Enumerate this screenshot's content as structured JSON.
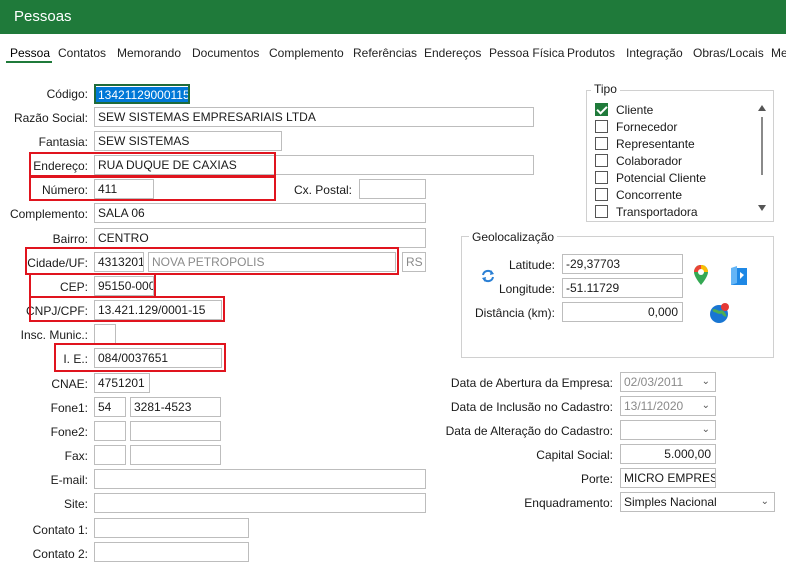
{
  "window": {
    "title": "Pessoas"
  },
  "tabs": [
    "Pessoa",
    "Contatos",
    "Memorando",
    "Documentos",
    "Complemento",
    "Referências",
    "Endereços",
    "Pessoa Física",
    "Produtos",
    "Integração",
    "Obras/Locais",
    "Me"
  ],
  "form": {
    "codigo": {
      "label": "Código:",
      "value": "13421129000115"
    },
    "razao_social": {
      "label": "Razão Social:",
      "value": "SEW SISTEMAS EMPRESARIAIS LTDA"
    },
    "fantasia": {
      "label": "Fantasia:",
      "value": "SEW SISTEMAS"
    },
    "endereco": {
      "label": "Endereço:",
      "value": "RUA DUQUE DE CAXIAS"
    },
    "numero": {
      "label": "Número:",
      "value": "411"
    },
    "cx_postal": {
      "label": "Cx. Postal:",
      "value": ""
    },
    "complemento": {
      "label": "Complemento:",
      "value": "SALA 06"
    },
    "bairro": {
      "label": "Bairro:",
      "value": "CENTRO"
    },
    "cidade_uf": {
      "label": "Cidade/UF:",
      "codigo": "4313201",
      "cidade": "NOVA PETROPOLIS",
      "uf": "RS"
    },
    "cep": {
      "label": "CEP:",
      "value": "95150-000"
    },
    "cnpj_cpf": {
      "label": "CNPJ/CPF:",
      "value": "13.421.129/0001-15"
    },
    "insc_munic": {
      "label": "Insc. Munic.:",
      "value": ""
    },
    "ie": {
      "label": "I. E.:",
      "value": "084/0037651"
    },
    "cnae": {
      "label": "CNAE:",
      "value": "4751201"
    },
    "fone1": {
      "label": "Fone1:",
      "ddd": "54",
      "numero": "3281-4523"
    },
    "fone2": {
      "label": "Fone2:",
      "ddd": "",
      "numero": ""
    },
    "fax": {
      "label": "Fax:",
      "ddd": "",
      "numero": ""
    },
    "email": {
      "label": "E-mail:",
      "value": ""
    },
    "site": {
      "label": "Site:",
      "value": ""
    },
    "contato1": {
      "label": "Contato 1:",
      "value": ""
    },
    "contato2": {
      "label": "Contato 2:",
      "value": ""
    }
  },
  "tipo": {
    "label": "Tipo",
    "items": [
      {
        "label": "Cliente",
        "checked": true
      },
      {
        "label": "Fornecedor",
        "checked": false
      },
      {
        "label": "Representante",
        "checked": false
      },
      {
        "label": "Colaborador",
        "checked": false
      },
      {
        "label": "Potencial Cliente",
        "checked": false
      },
      {
        "label": "Concorrente",
        "checked": false
      },
      {
        "label": "Transportadora",
        "checked": false
      }
    ]
  },
  "geo": {
    "label": "Geolocalização",
    "latitude_label": "Latitude:",
    "latitude": "-29,37703",
    "longitude_label": "Longitude:",
    "longitude": "-51.11729",
    "distancia_label": "Distância (km):",
    "distancia": "0,000"
  },
  "empresa": {
    "abertura_label": "Data de Abertura da Empresa:",
    "abertura": "02/03/2011",
    "inclusao_label": "Data de Inclusão no Cadastro:",
    "inclusao": "13/11/2020",
    "alteracao_label": "Data de Alteração do Cadastro:",
    "alteracao": "",
    "capital_label": "Capital Social:",
    "capital": "5.000,00",
    "porte_label": "Porte:",
    "porte": "MICRO EMPRESA",
    "enquadramento_label": "Enquadramento:",
    "enquadramento": "Simples Nacional"
  },
  "colors": {
    "titlebar": "#1f7a3a",
    "highlight": "#e0141e",
    "selection": "#0078d7"
  },
  "icons": [
    "refresh-icon",
    "map-pin-icon",
    "map-icon",
    "globe-icon",
    "chevron-down-icon",
    "scroll-up-icon",
    "scroll-down-icon"
  ]
}
